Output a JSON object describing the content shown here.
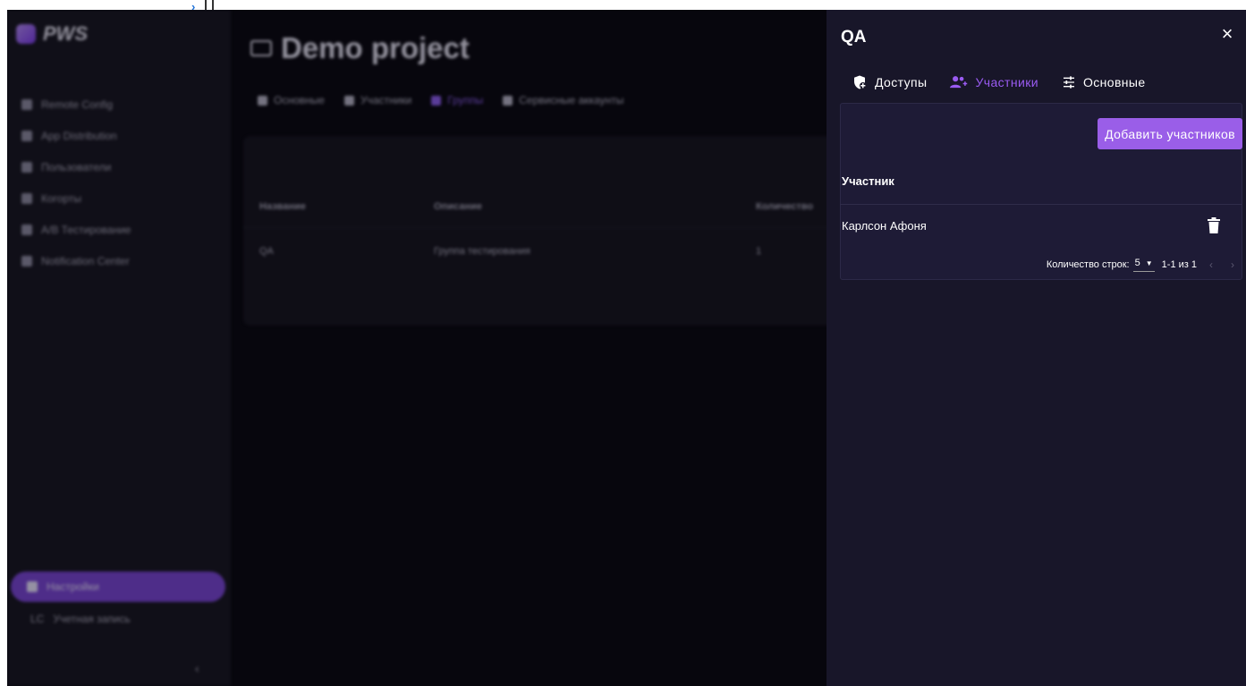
{
  "background": {
    "sidebar": {
      "logo": "PWS",
      "items": [
        {
          "label": "Remote Config",
          "icon": "grid-icon"
        },
        {
          "label": "App Distribution",
          "icon": "box-icon"
        },
        {
          "label": "Пользователи",
          "icon": "users-icon"
        },
        {
          "label": "Когорты",
          "icon": "cohort-icon"
        },
        {
          "label": "A/B Тестирование",
          "icon": "flask-icon"
        },
        {
          "label": "Notification Center",
          "icon": "send-icon"
        }
      ],
      "settings": "Настройки",
      "account": "Учетная запись",
      "account_initials": "LC"
    },
    "project_title": "Demo project",
    "tabs": [
      "Основные",
      "Участники",
      "Группы",
      "Сервисные аккаунты"
    ],
    "active_tab": "Группы",
    "table": {
      "headers": [
        "Название",
        "Описание",
        "Количество"
      ],
      "rows": [
        [
          "QA",
          "Группа тестирования",
          "1"
        ]
      ]
    }
  },
  "drawer": {
    "title": "QA",
    "close": "×",
    "tabs": [
      {
        "label": "Доступы",
        "icon": "shield-plus-icon"
      },
      {
        "label": "Участники",
        "icon": "group-add-icon"
      },
      {
        "label": "Основные",
        "icon": "tune-icon"
      }
    ],
    "active_tab": "Участники",
    "add_button": "Добавить участников",
    "column_header": "Участник",
    "members": [
      {
        "name": "Карлсон Афоня"
      }
    ],
    "pagination": {
      "rows_label": "Количество строк:",
      "rows_value": "5",
      "range": "1-1 из 1",
      "prev": "‹",
      "next": "›"
    }
  },
  "colors": {
    "accent": "#9a5ee8",
    "drawer_bg": "#181629",
    "panel_bg": "#1e1b36"
  }
}
